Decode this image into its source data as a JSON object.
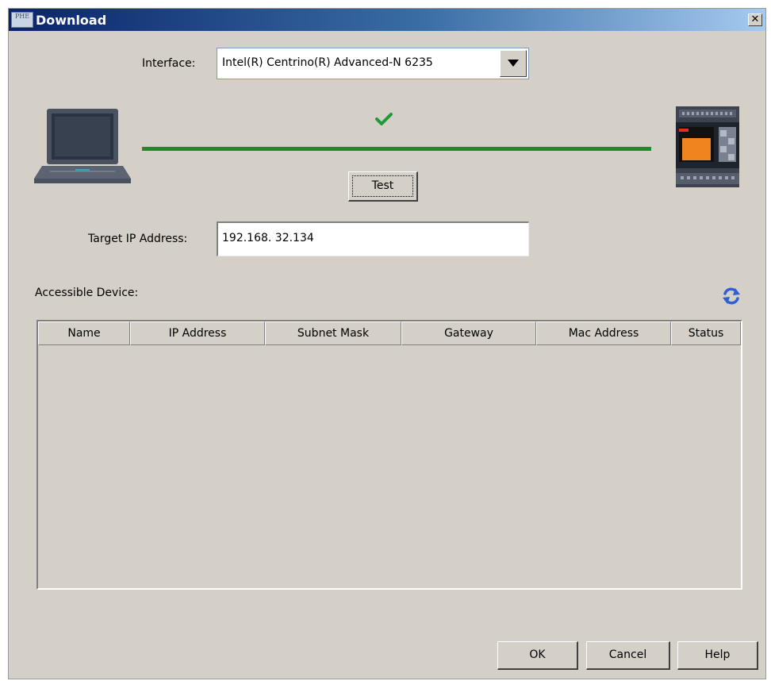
{
  "window": {
    "title": "Download",
    "close_glyph": "✕",
    "icon_text": "PHE"
  },
  "interface": {
    "label": "Interface:",
    "selected": "Intel(R) Centrino(R) Advanced-N 6235"
  },
  "connection": {
    "status": "connected",
    "test_label": "Test",
    "line_color": "#1e8a2e",
    "check_color": "#1e9a3a"
  },
  "target_ip": {
    "label": "Target IP Address:",
    "value": "192.168. 32.134"
  },
  "devices": {
    "label": "Accessible Device:",
    "columns": [
      "Name",
      "IP Address",
      "Subnet Mask",
      "Gateway",
      "Mac Address",
      "Status"
    ],
    "rows": []
  },
  "footer": {
    "ok_label": "OK",
    "cancel_label": "Cancel",
    "help_label": "Help"
  },
  "icons": {
    "laptop": "laptop-icon",
    "plc": "plc-device-icon",
    "refresh": "refresh-icon",
    "check": "check-icon",
    "dropdown": "dropdown-arrow-icon"
  }
}
